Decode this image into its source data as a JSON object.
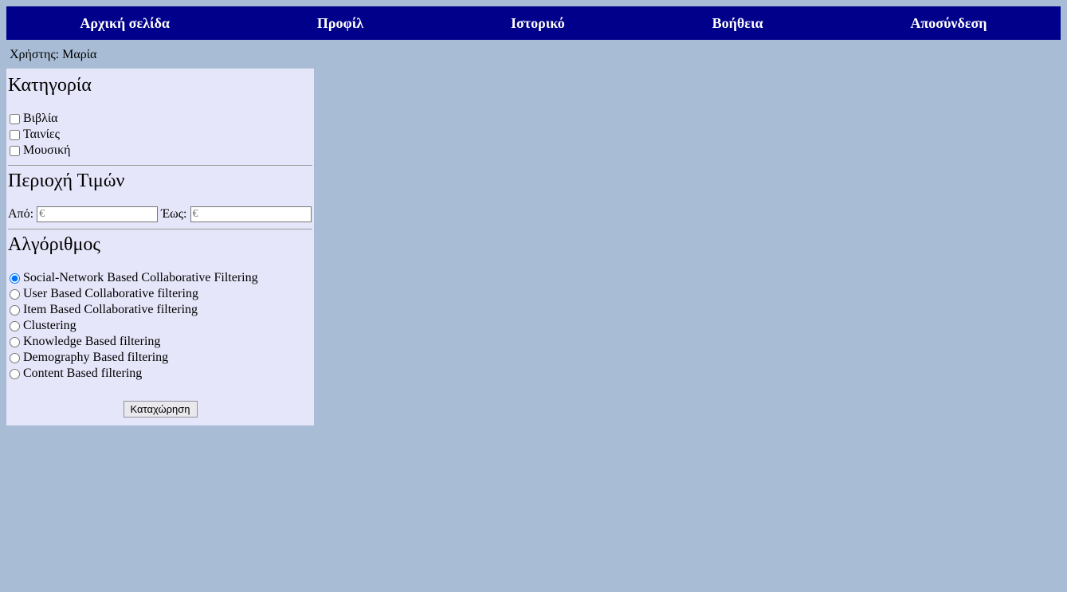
{
  "nav": {
    "home": "Αρχική σελίδα",
    "profile": "Προφίλ",
    "history": "Ιστορικό",
    "help": "Βοήθεια",
    "logout": "Αποσύνδεση"
  },
  "user_label": "Χρήστης: Μαρία",
  "sidebar": {
    "category": {
      "title": "Κατηγορία",
      "options": {
        "books": "Βιβλία",
        "movies": "Ταινίες",
        "music": "Μουσική"
      }
    },
    "price": {
      "title": "Περιοχή Τιμών",
      "from_label": "Από:",
      "to_label": "Έως:",
      "placeholder": "€"
    },
    "algorithm": {
      "title": "Αλγόριθμος",
      "options": {
        "social": "Social-Network Based Collaborative Filtering",
        "user": "User Based Collaborative filtering",
        "item": "Item Based Collaborative filtering",
        "clustering": "Clustering",
        "knowledge": "Knowledge Based filtering",
        "demography": "Demography Based filtering",
        "content": "Content Based filtering"
      }
    },
    "submit": "Καταχώρηση"
  }
}
